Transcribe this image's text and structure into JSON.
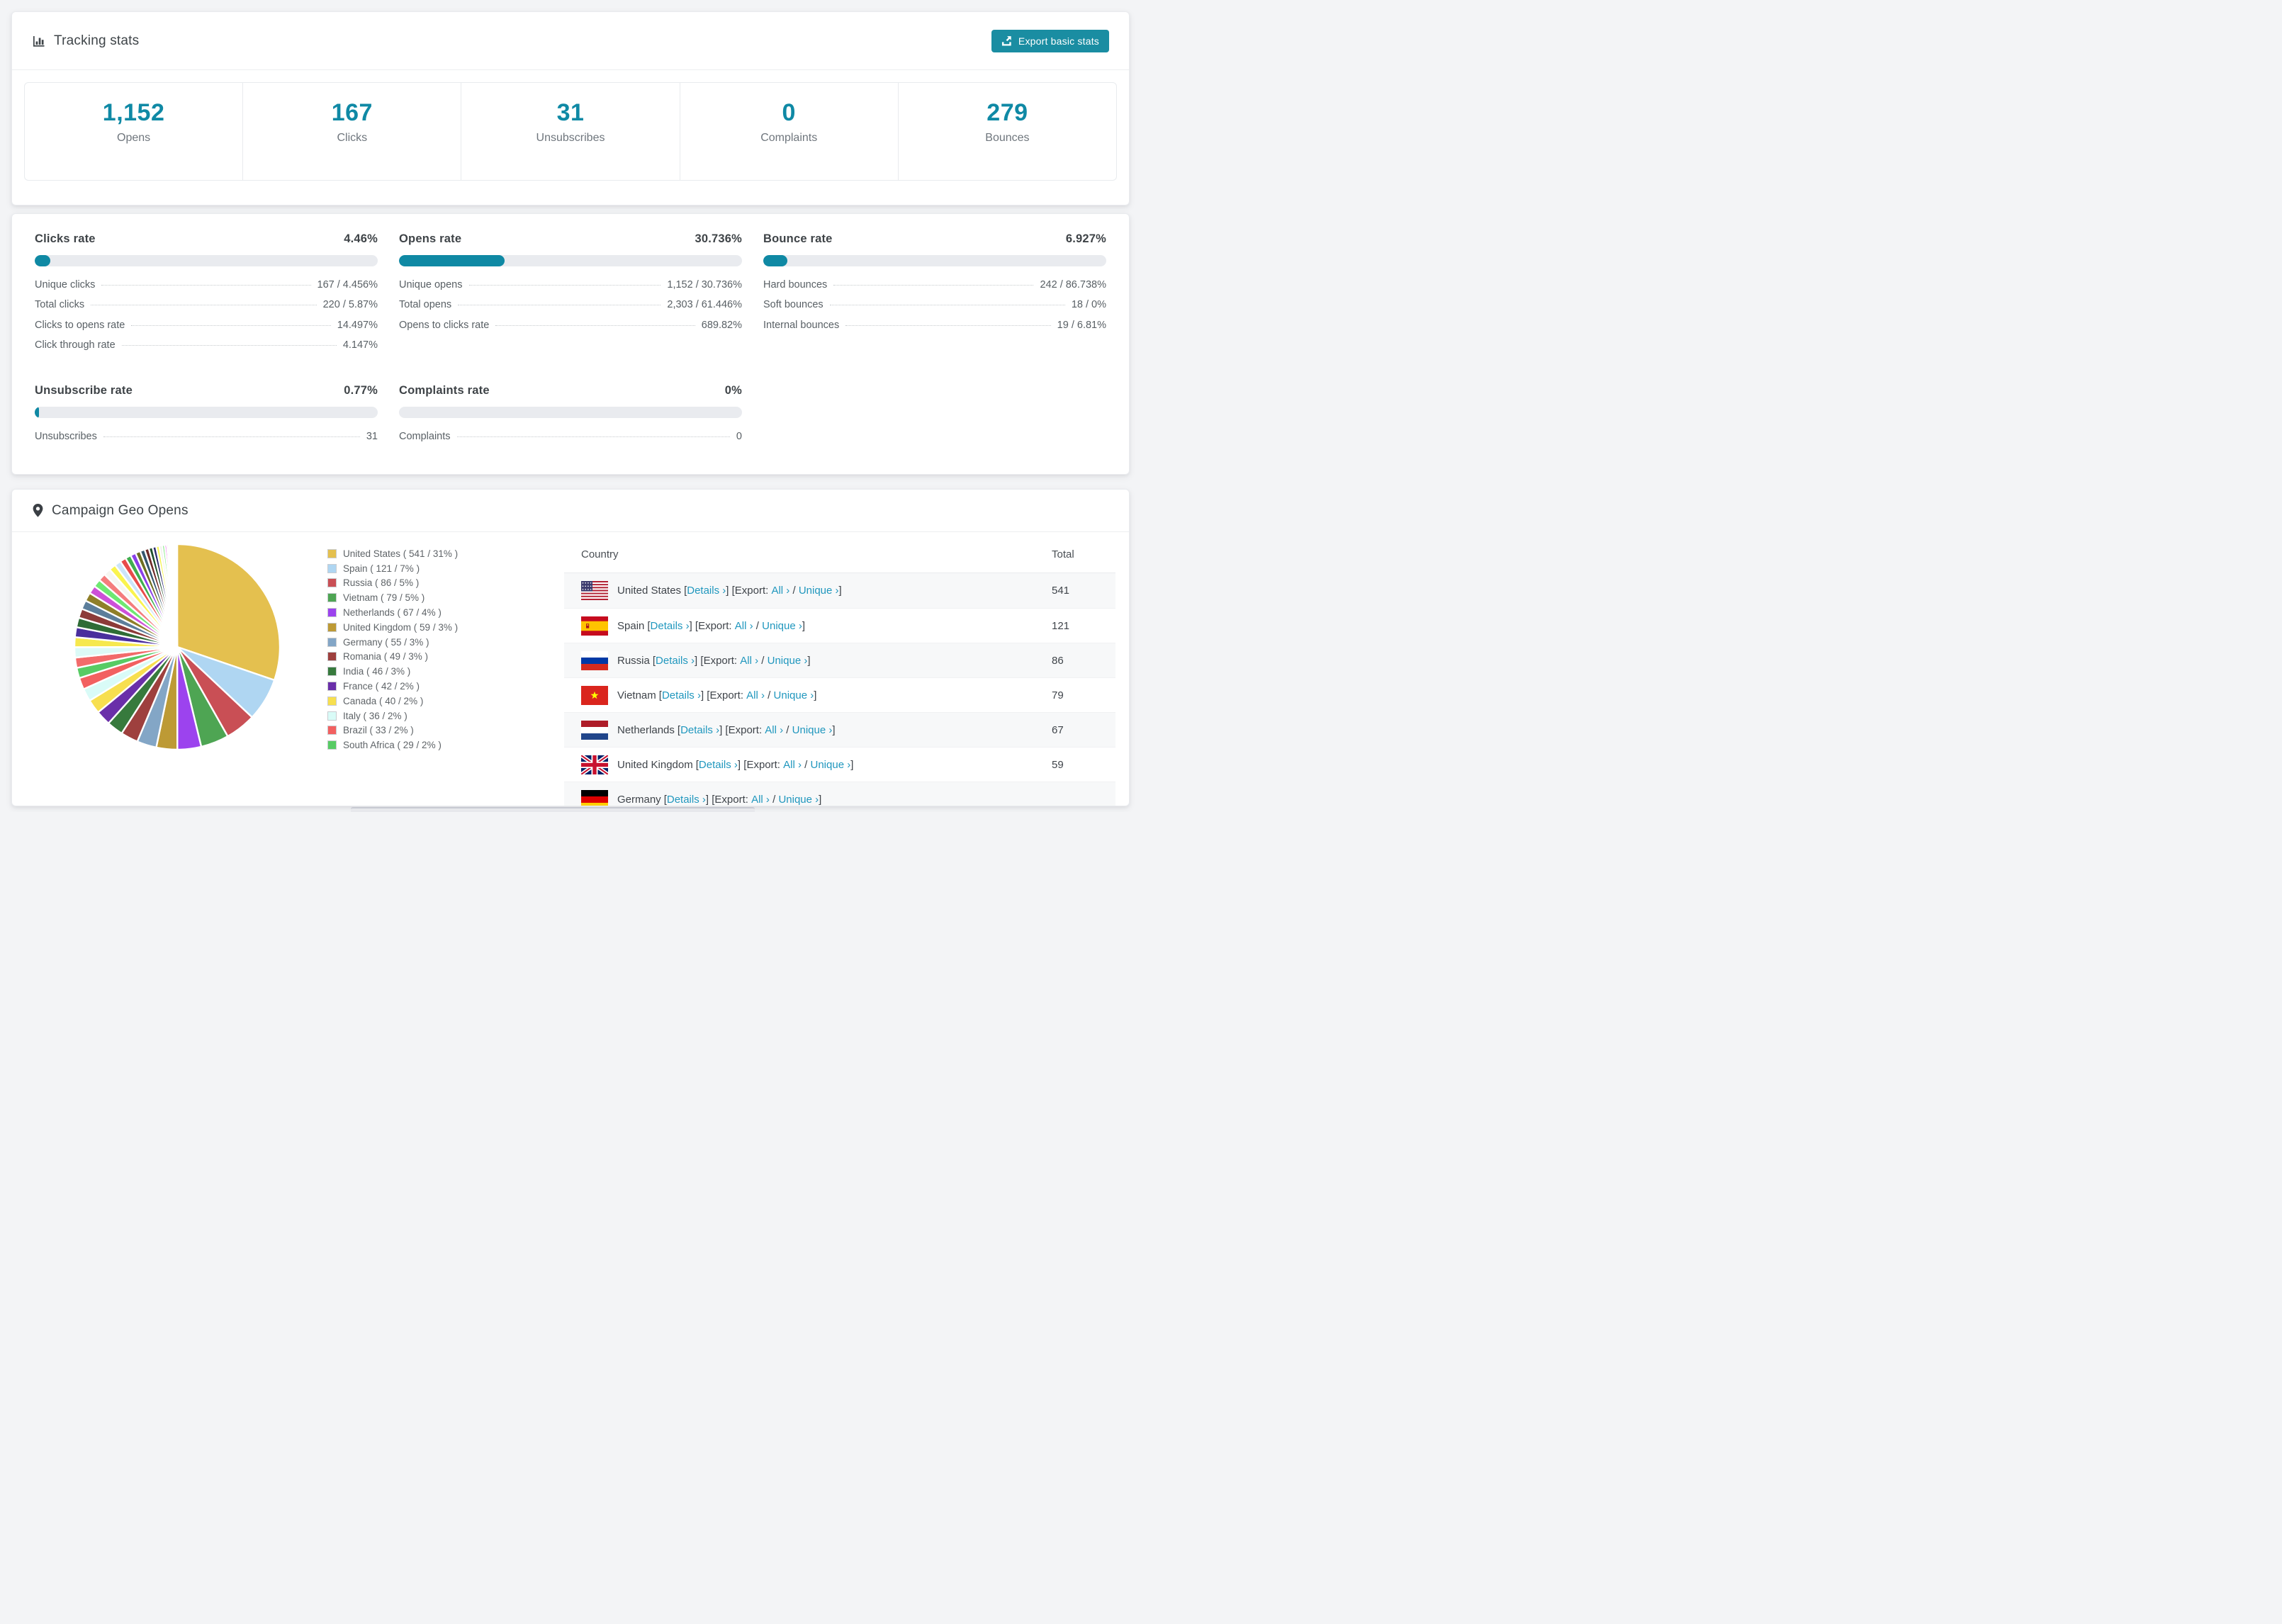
{
  "accent": "#0F89A5",
  "tracking": {
    "title": "Tracking stats",
    "export_button": "Export basic stats",
    "stats": [
      {
        "value": "1,152",
        "label": "Opens"
      },
      {
        "value": "167",
        "label": "Clicks"
      },
      {
        "value": "31",
        "label": "Unsubscribes"
      },
      {
        "value": "0",
        "label": "Complaints"
      },
      {
        "value": "279",
        "label": "Bounces"
      }
    ]
  },
  "rates": [
    {
      "title": "Clicks rate",
      "value": "4.46%",
      "percent": 4.46,
      "rows": [
        {
          "label": "Unique clicks",
          "value": "167 / 4.456%"
        },
        {
          "label": "Total clicks",
          "value": "220 / 5.87%"
        },
        {
          "label": "Clicks to opens rate",
          "value": "14.497%"
        },
        {
          "label": "Click through rate",
          "value": "4.147%"
        }
      ]
    },
    {
      "title": "Opens rate",
      "value": "30.736%",
      "percent": 30.736,
      "rows": [
        {
          "label": "Unique opens",
          "value": "1,152 / 30.736%"
        },
        {
          "label": "Total opens",
          "value": "2,303 / 61.446%"
        },
        {
          "label": "Opens to clicks rate",
          "value": "689.82%"
        }
      ]
    },
    {
      "title": "Bounce rate",
      "value": "6.927%",
      "percent": 6.927,
      "rows": [
        {
          "label": "Hard bounces",
          "value": "242 / 86.738%"
        },
        {
          "label": "Soft bounces",
          "value": "18 / 0%"
        },
        {
          "label": "Internal bounces",
          "value": "19 / 6.81%"
        }
      ]
    },
    {
      "title": "Unsubscribe rate",
      "value": "0.77%",
      "percent": 0.77,
      "rows": [
        {
          "label": "Unsubscribes",
          "value": "31"
        }
      ]
    },
    {
      "title": "Complaints rate",
      "value": "0%",
      "percent": 0,
      "rows": [
        {
          "label": "Complaints",
          "value": "0"
        }
      ]
    }
  ],
  "geo": {
    "title": "Campaign Geo Opens",
    "table": {
      "columns": [
        "Country",
        "Total"
      ],
      "link_details": "Details",
      "label_export": "Export:",
      "link_all": "All",
      "link_unique": "Unique",
      "rows": [
        {
          "country": "United States",
          "total": "541",
          "flag": "us"
        },
        {
          "country": "Spain",
          "total": "121",
          "flag": "es"
        },
        {
          "country": "Russia",
          "total": "86",
          "flag": "ru"
        },
        {
          "country": "Vietnam",
          "total": "79",
          "flag": "vn"
        },
        {
          "country": "Netherlands",
          "total": "67",
          "flag": "nl"
        },
        {
          "country": "United Kingdom",
          "total": "59",
          "flag": "gb"
        },
        {
          "country": "Germany",
          "total": "",
          "flag": "de",
          "partial": true
        }
      ]
    }
  },
  "chart_data": {
    "type": "pie",
    "title": "Campaign Geo Opens",
    "legend_position": "right-of-pie",
    "slices": [
      {
        "label": "United States",
        "value": 541,
        "percent": 31,
        "color": "#E4C04F"
      },
      {
        "label": "Spain",
        "value": 121,
        "percent": 7,
        "color": "#AFD6F2"
      },
      {
        "label": "Russia",
        "value": 86,
        "percent": 5,
        "color": "#C94F55"
      },
      {
        "label": "Vietnam",
        "value": 79,
        "percent": 5,
        "color": "#4EA553"
      },
      {
        "label": "Netherlands",
        "value": 67,
        "percent": 4,
        "color": "#9C43EE"
      },
      {
        "label": "United Kingdom",
        "value": 59,
        "percent": 3,
        "color": "#BD9A35"
      },
      {
        "label": "Germany",
        "value": 55,
        "percent": 3,
        "color": "#83A6C6"
      },
      {
        "label": "Romania",
        "value": 49,
        "percent": 3,
        "color": "#9E403E"
      },
      {
        "label": "India",
        "value": 46,
        "percent": 3,
        "color": "#377A3D"
      },
      {
        "label": "France",
        "value": 42,
        "percent": 2,
        "color": "#6A2FA9"
      },
      {
        "label": "Canada",
        "value": 40,
        "percent": 2,
        "color": "#F7DF4F"
      },
      {
        "label": "Italy",
        "value": 36,
        "percent": 2,
        "color": "#D9FBF7"
      },
      {
        "label": "Brazil",
        "value": 33,
        "percent": 2,
        "color": "#F26060"
      },
      {
        "label": "South Africa",
        "value": 29,
        "percent": 2,
        "color": "#57CB64"
      }
    ],
    "others_unlabeled": {
      "values": [
        29,
        29,
        28,
        28,
        27,
        26,
        25,
        24,
        23,
        22,
        21,
        20,
        19,
        18,
        17,
        16,
        15,
        14,
        13,
        12,
        11,
        10,
        9,
        8,
        7,
        6,
        5,
        4,
        3,
        3,
        2,
        2,
        2,
        2,
        1,
        1,
        1,
        1,
        1,
        1
      ],
      "colors": [
        "#F26B6B",
        "#DCFAF7",
        "#F6E84E",
        "#4A2E9D",
        "#2F6C36",
        "#8C3B39",
        "#5C7E9B",
        "#8F7F28",
        "#CD50D8",
        "#6EE872",
        "#F47C7C",
        "#F6F6F1",
        "#FAF44E",
        "#CBE5FA",
        "#E84B4B",
        "#40AE4F",
        "#8A40E9",
        "#6E6E21",
        "#34566E",
        "#6E2B29",
        "#20502B",
        "#2B2B6E",
        "#F5F44F",
        "#EFEFE9",
        "#7DE87D",
        "#E850E8",
        "#F78C8C",
        "#D4A938",
        "#A8D0F0",
        "#E05151",
        "#45B250",
        "#7B40D8",
        "#99992C",
        "#409AA8",
        "#E87CB0",
        "#BFBFC4",
        "#5151C0",
        "#F0D061",
        "#90E0C0",
        "#D081F0"
      ]
    }
  }
}
